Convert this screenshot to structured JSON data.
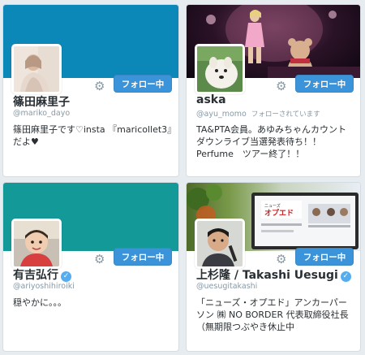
{
  "cards": [
    {
      "name": "篠田麻里子",
      "handle": "@mariko_dayo",
      "follows_you": "",
      "verified": false,
      "bio": "篠田麻里子です♡insta 『maricollet3』だよ♥",
      "button": "フォロー中",
      "banner_color": "#0b87b8"
    },
    {
      "name": "aska",
      "handle": "@ayu_momo",
      "follows_you": "フォローされています",
      "verified": false,
      "bio": "TA&PTA会員。あゆみちゃんカウントダウンライブ当選発表待ち！！\nPerfume　ツアー終了！！",
      "button": "フォロー中",
      "banner_color": "#2a1226"
    },
    {
      "name": "有吉弘行",
      "handle": "@ariyoshihiroiki",
      "follows_you": "",
      "verified": true,
      "bio": "穏やかに。。。",
      "button": "フォロー中",
      "banner_color": "#149999"
    },
    {
      "name": "上杉隆 / Takashi Uesugi",
      "handle": "@uesugitakashi",
      "follows_you": "",
      "verified": true,
      "bio": "「ニューズ・オプエド」アンカーパーソン ㈱ NO BORDER 代表取締役社長（無期限つぶやき休止中",
      "button": "フォロー中",
      "banner_color": "#7a9a4a"
    }
  ],
  "icons": {
    "settings": "gear-icon",
    "verified": "verified-badge-icon",
    "verified_glyph": "✓",
    "gear_glyph": "⚙"
  },
  "colors": {
    "page_bg": "#e6ecf0",
    "follow_button": "#3b94d9",
    "verified": "#55acee"
  }
}
